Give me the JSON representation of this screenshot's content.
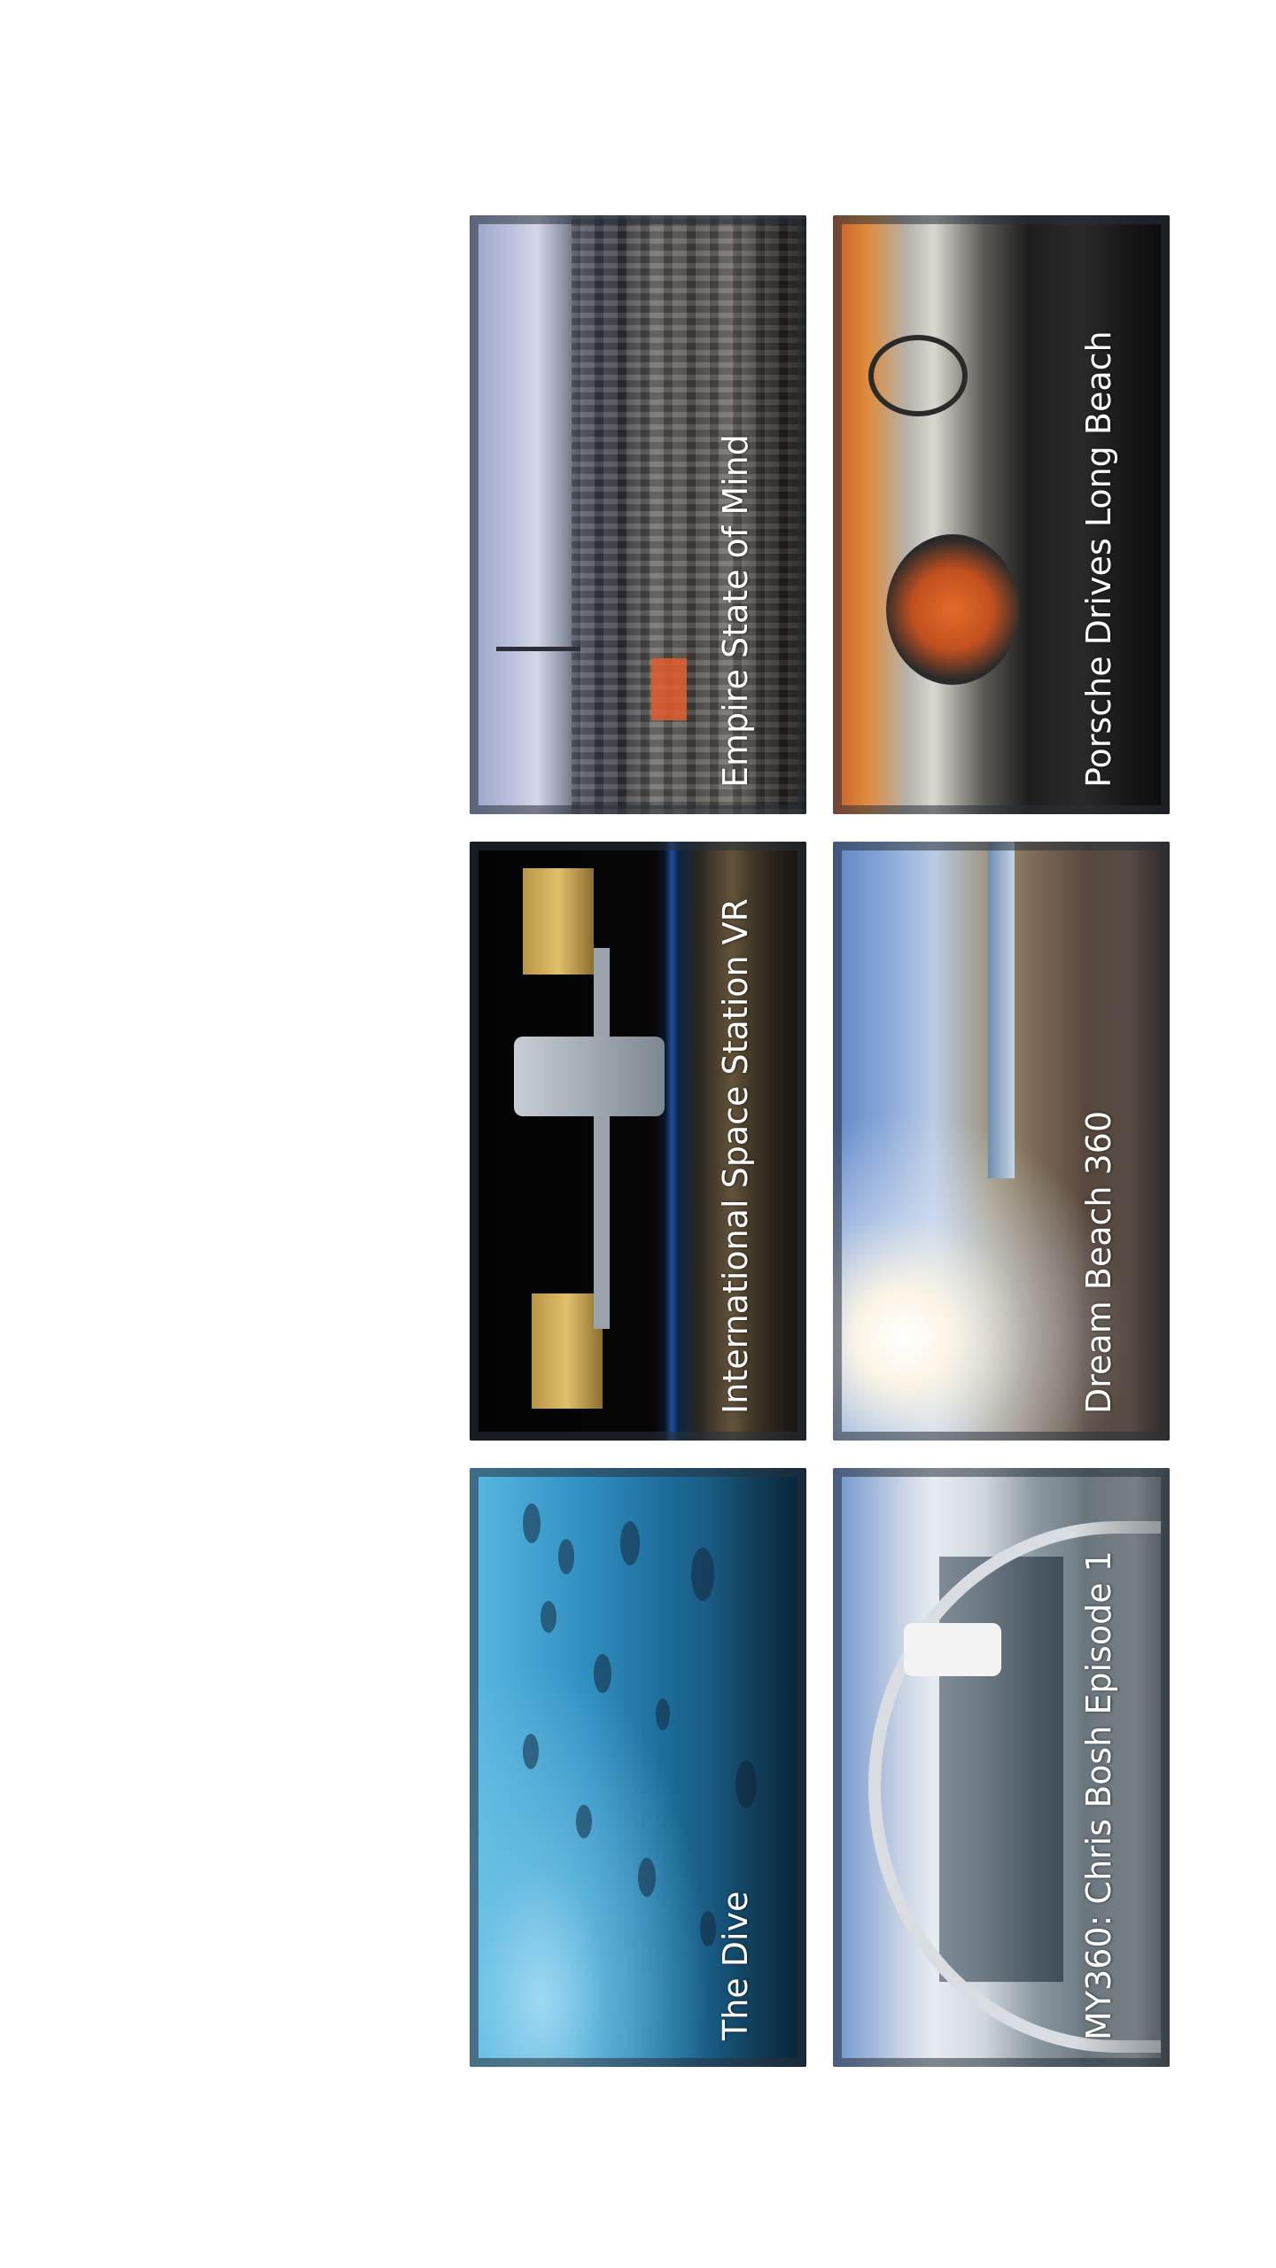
{
  "videos": [
    {
      "title": "Empire State of Mind"
    },
    {
      "title": "Porsche Drives Long Beach"
    },
    {
      "title": "International Space Station VR"
    },
    {
      "title": "Dream Beach 360"
    },
    {
      "title": "The Dive"
    },
    {
      "title": "MY360: Chris Bosh Episode 1"
    }
  ]
}
